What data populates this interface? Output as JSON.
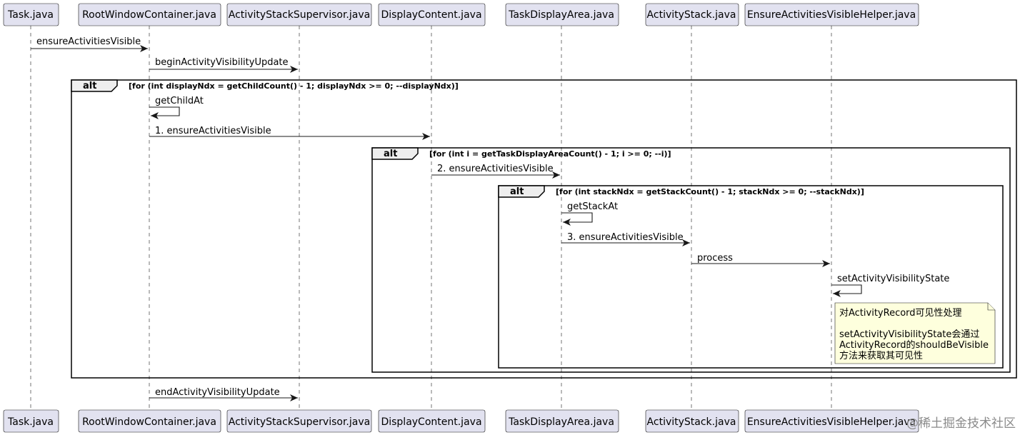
{
  "participants": [
    "Task.java",
    "RootWindowContainer.java",
    "ActivityStackSupervisor.java",
    "DisplayContent.java",
    "TaskDisplayArea.java",
    "ActivityStack.java",
    "EnsureActivitiesVisibleHelper.java"
  ],
  "messages": [
    {
      "label": "ensureActivitiesVisible"
    },
    {
      "label": "beginActivityVisibilityUpdate"
    },
    {
      "label": "getChildAt"
    },
    {
      "label": "1. ensureActivitiesVisible"
    },
    {
      "label": "2. ensureActivitiesVisible"
    },
    {
      "label": "getStackAt"
    },
    {
      "label": "3. ensureActivitiesVisible"
    },
    {
      "label": "process"
    },
    {
      "label": "setActivityVisibilityState"
    },
    {
      "label": "endActivityVisibilityUpdate"
    }
  ],
  "frames": [
    {
      "keyword": "alt",
      "guard": "[for (int displayNdx = getChildCount() - 1; displayNdx >= 0; --displayNdx)]"
    },
    {
      "keyword": "alt",
      "guard": "[for (int i = getTaskDisplayAreaCount() - 1; i >= 0; --i)]"
    },
    {
      "keyword": "alt",
      "guard": "[for (int stackNdx = getStackCount() - 1; stackNdx >= 0; --stackNdx)]"
    }
  ],
  "note": {
    "lines": [
      "对ActivityRecord可见性处理",
      "",
      "setActivityVisibilityState会通过",
      "ActivityRecord的shouldBeVisible",
      "方法来获取其可见性"
    ]
  },
  "watermark": "@稀土掘金技术社区",
  "colors": {
    "participant_fill": "#E2E2F0",
    "note_fill": "#FEFFDD",
    "frame_tab_fill": "#EEEEEE",
    "line": "#181818"
  }
}
